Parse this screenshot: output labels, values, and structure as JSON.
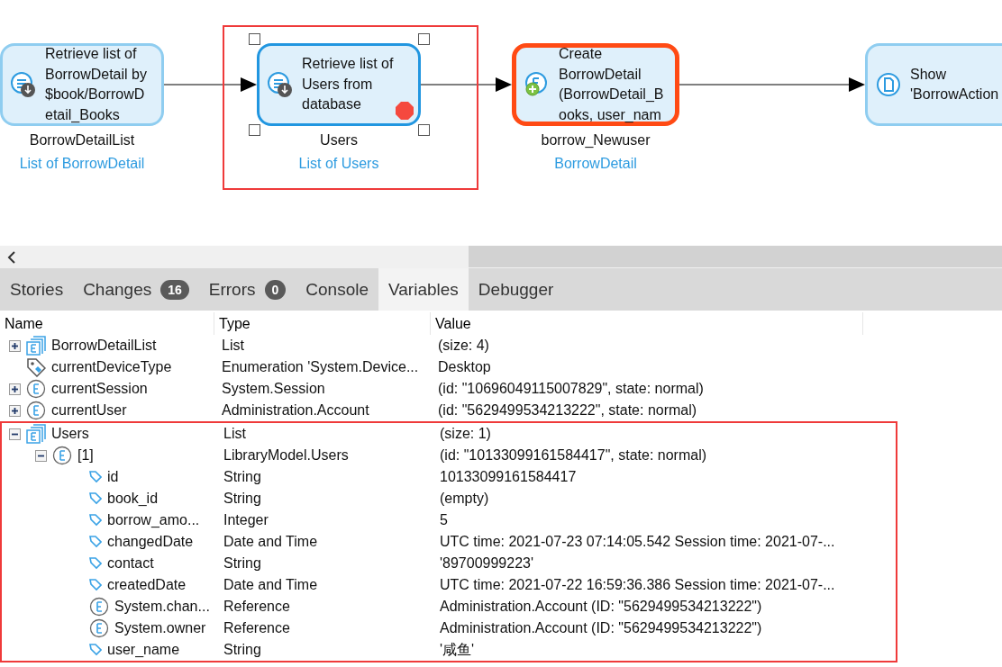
{
  "flow": {
    "nodes": [
      {
        "kind": "retrieve",
        "lines": [
          "Retrieve list of",
          "BorrowDetail by",
          "$book/BorrowD",
          "etail_Books"
        ],
        "output_name": "BorrowDetailList",
        "output_type": "List of BorrowDetail",
        "selected": false,
        "breakpoint": false,
        "current": false,
        "highlighted": false
      },
      {
        "kind": "retrieve",
        "lines": [
          "Retrieve list of",
          "Users from",
          "database"
        ],
        "output_name": "Users",
        "output_type": "List of Users",
        "selected": true,
        "breakpoint": true,
        "current": false,
        "highlighted": true
      },
      {
        "kind": "create",
        "lines": [
          "Create",
          "BorrowDetail",
          "(BorrowDetail_B",
          "ooks,  user_nam"
        ],
        "output_name": "borrow_Newuser",
        "output_type": "BorrowDetail",
        "selected": false,
        "breakpoint": false,
        "current": true,
        "highlighted": false
      },
      {
        "kind": "show",
        "lines": [
          "Show",
          "'BorrowAction"
        ],
        "selected": false,
        "breakpoint": false,
        "current": false,
        "highlighted": false
      }
    ]
  },
  "tabs": [
    {
      "label": "Stories",
      "selected": false
    },
    {
      "label": "Changes",
      "badge": "16",
      "selected": false
    },
    {
      "label": "Errors",
      "badge": "0",
      "selected": false
    },
    {
      "label": "Console",
      "selected": false
    },
    {
      "label": "Variables",
      "selected": true
    },
    {
      "label": "Debugger",
      "selected": false
    }
  ],
  "variables": {
    "columns": [
      "Name",
      "Type",
      "Value"
    ],
    "rows": [
      {
        "kind": "list",
        "name": "BorrowDetailList",
        "type": "List",
        "value": "(size: 4)",
        "expanded": false,
        "highlighted": false
      },
      {
        "kind": "enumeration",
        "name": "currentDeviceType",
        "type": "Enumeration 'System.Device...",
        "value": "Desktop",
        "highlighted": false
      },
      {
        "kind": "object",
        "name": "currentSession",
        "type": "System.Session",
        "value": "(id: \"10696049115007829\", state: normal)",
        "expanded": false,
        "highlighted": false
      },
      {
        "kind": "object",
        "name": "currentUser",
        "type": "Administration.Account",
        "value": "(id: \"5629499534213222\", state: normal)",
        "expanded": false,
        "highlighted": false
      },
      {
        "kind": "list",
        "name": "Users",
        "type": "List",
        "value": "(size: 1)",
        "expanded": true,
        "highlighted": true,
        "children": [
          {
            "kind": "object",
            "name": "[1]",
            "type": "LibraryModel.Users",
            "value": "(id: \"10133099161584417\", state: normal)",
            "expanded": true,
            "highlighted": false,
            "children": [
              {
                "kind": "attribute",
                "name": "id",
                "type": "String",
                "value": "10133099161584417",
                "highlighted": false
              },
              {
                "kind": "attribute",
                "name": "book_id",
                "type": "String",
                "value": "(empty)",
                "highlighted": false
              },
              {
                "kind": "attribute",
                "name": "borrow_amo...",
                "type": "Integer",
                "value": "5",
                "highlighted": false
              },
              {
                "kind": "attribute",
                "name": "changedDate",
                "type": "Date and Time",
                "value": "UTC time: 2021-07-23 07:14:05.542 Session time: 2021-07-...",
                "highlighted": false
              },
              {
                "kind": "attribute",
                "name": "contact",
                "type": "String",
                "value": "'89700999223'",
                "highlighted": false
              },
              {
                "kind": "attribute",
                "name": "createdDate",
                "type": "Date and Time",
                "value": "UTC time: 2021-07-22 16:59:36.386 Session time: 2021-07-...",
                "highlighted": false
              },
              {
                "kind": "object",
                "name": "System.chan...",
                "type": "Reference",
                "value": "Administration.Account (ID: \"5629499534213222\")",
                "highlighted": false
              },
              {
                "kind": "object",
                "name": "System.owner",
                "type": "Reference",
                "value": "Administration.Account (ID: \"5629499534213222\")",
                "highlighted": false
              },
              {
                "kind": "attribute",
                "name": "user_name",
                "type": "String",
                "value": "'咸鱼'",
                "highlighted": false
              }
            ]
          }
        ]
      }
    ]
  }
}
